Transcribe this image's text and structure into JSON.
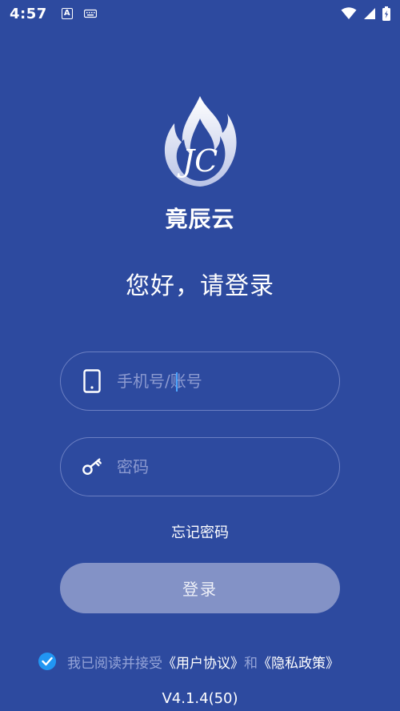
{
  "status_bar": {
    "time": "4:57",
    "icons": [
      "a-notification-icon",
      "keyboard-icon",
      "wifi-icon",
      "signal-icon",
      "battery-icon"
    ]
  },
  "app": {
    "logo_letters": "JC",
    "name": "竟辰云"
  },
  "login": {
    "greeting": "您好，请登录",
    "phone_placeholder": "手机号/账号",
    "phone_value": "",
    "password_placeholder": "密码",
    "password_value": "",
    "forgot_label": "忘记密码",
    "submit_label": "登录"
  },
  "agreement": {
    "checked": true,
    "prefix": "我已阅读并接受",
    "user_agreement": "《用户协议》",
    "conjunction": "和",
    "privacy_policy": "《隐私政策》"
  },
  "version": "V4.1.4(50)",
  "colors": {
    "background": "#2d4a9f",
    "field_border": "#6b7fc2",
    "button": "#8392c6",
    "accent": "#2196f3"
  }
}
